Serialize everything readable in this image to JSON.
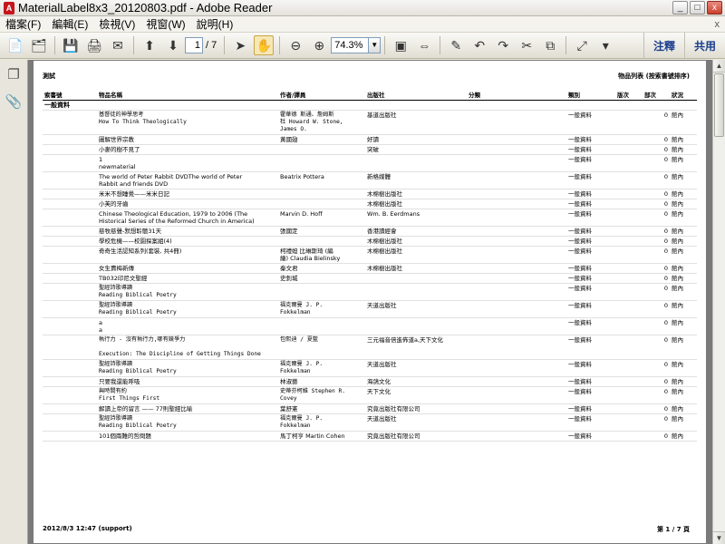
{
  "window": {
    "title": "MaterialLabel8x3_20120803.pdf - Adobe Reader",
    "buttons": [
      "_",
      "□",
      "x"
    ]
  },
  "menu": [
    "檔案(F)",
    "編輯(E)",
    "檢視(V)",
    "視窗(W)",
    "說明(H)"
  ],
  "menu_close": "x",
  "toolbar": {
    "page_current": "1",
    "page_total": "/ 7",
    "zoom": "74.3%",
    "comment_label": "注釋",
    "share_label": "共用"
  },
  "page": {
    "header_left": "測試",
    "header_right": "物品列表 (按索書號排序)",
    "columns": [
      "索書號",
      "物品名稱",
      "作者/譯員",
      "出版社",
      "分類",
      "類別",
      "版次",
      "部次",
      "狀況"
    ],
    "section": "一般資料",
    "rows": [
      {
        "title": "基督徒的神學思考\nHow To Think Theologically",
        "author": "霍華德 斯通、詹姆斯\n杜 Howard W. Stone,\nJames O.",
        "publisher": "基道出版社",
        "category": "一般資料",
        "copies": "0",
        "status": "館內",
        "mono": true
      },
      {
        "title": "圖解世界宗教",
        "author": "黃國翅",
        "publisher": "好讀",
        "category": "一般資料",
        "copies": "0",
        "status": "館內"
      },
      {
        "title": "小麥的樹不見了",
        "author": "",
        "publisher": "突破",
        "category": "一般資料",
        "copies": "0",
        "status": "館內"
      },
      {
        "title": "1\nnewmaterial",
        "author": "",
        "publisher": "",
        "category": "一般資料",
        "copies": "0",
        "status": "館內"
      },
      {
        "title": "The world of Peter Rabbit DVDThe world of Peter\nRabbit and friends DVD",
        "author": "Beatrix Pottera",
        "publisher": "新格媒體",
        "category": "一般資料",
        "copies": "0",
        "status": "館內"
      },
      {
        "title": "米米不想睡覺——米米日記",
        "author": "",
        "publisher": "木棉樹出版社",
        "category": "一般資料",
        "copies": "0",
        "status": "館內"
      },
      {
        "title": "小芙的牙齒",
        "author": "",
        "publisher": "木棉樹出版社",
        "category": "一般資料",
        "copies": "0",
        "status": "館內"
      },
      {
        "title": "Chinese Theological Education, 1979 to 2006 (The\nHistorical Series of the Reformed Church in America)",
        "author": "Marvin D. Hoff",
        "publisher": "Wm. B. Eerdmans",
        "category": "一般資料",
        "copies": "0",
        "status": "館內"
      },
      {
        "title": "慈牧慈聲-默想聆聽31天",
        "author": "張國定",
        "publisher": "香港讀經會",
        "category": "一般資料",
        "copies": "0",
        "status": "館內"
      },
      {
        "title": "學校危機——校園探案組(4)",
        "author": "",
        "publisher": "木棉樹出版社",
        "category": "一般資料",
        "copies": "0",
        "status": "館內"
      },
      {
        "title": "奇奇生活認知系列(套裝, 共4冊)",
        "author": "柯禮妲 比琳斯琦 (編\n繪) Claudia Bielinsky",
        "publisher": "木棉樹出版社",
        "category": "一般資料",
        "copies": "0",
        "status": "館內"
      },
      {
        "title": "女生賣梅新傳",
        "author": "秦文君",
        "publisher": "木棉樹出版社",
        "category": "一般資料",
        "copies": "0",
        "status": "館內"
      },
      {
        "title": "TB032印尼文聖經",
        "author": "史釗城",
        "publisher": "",
        "category": "一般資料",
        "copies": "0",
        "status": "館內"
      },
      {
        "title": "聖經詩歌導讀\nReading Biblical Poetry",
        "author": "",
        "publisher": "",
        "category": "一般資料",
        "copies": "0",
        "status": "館內",
        "mono": true
      },
      {
        "title": "聖經詩歌導讀\nReading Biblical Poetry",
        "author": "福克爾曼 J. P.\nFokkelman",
        "publisher": "天道出版社",
        "category": "一般資料",
        "copies": "0",
        "status": "館內",
        "mono": true
      },
      {
        "title": "a\na",
        "author": "",
        "publisher": "",
        "category": "一般資料",
        "copies": "0",
        "status": "館內"
      },
      {
        "title": "執行力 - 沒有執行力,哪有競爭力\n\nExecution: The Discipline of Getting Things Done",
        "author": "包熙迪 / 夏藍",
        "publisher": "三元福音倍進佈道a,天下文化",
        "category": "一般資料",
        "copies": "0",
        "status": "館內",
        "mono": true
      },
      {
        "title": "聖經詩歌導讀\nReading Biblical Poetry",
        "author": "福克爾曼 J. P.\nFokkelman",
        "publisher": "天道出版社",
        "category": "一般資料",
        "copies": "0",
        "status": "館內",
        "mono": true
      },
      {
        "title": "只要我還能呼吸",
        "author": "林淑藝",
        "publisher": "海鴿文化",
        "category": "一般資料",
        "copies": "0",
        "status": "館內"
      },
      {
        "title": "與時間有約\nFirst Things First",
        "author": "史蒂芬柯維 Stephen R.\nCovey",
        "publisher": "天下文化",
        "category": "一般資料",
        "copies": "0",
        "status": "館內",
        "mono": true
      },
      {
        "title": "解讀上帝的留言 —— 77則聖經比喻",
        "author": "葉舒憲",
        "publisher": "究竟出版社有限公司",
        "category": "一般資料",
        "copies": "0",
        "status": "館內"
      },
      {
        "title": "聖經詩歌導讀\nReading Biblical Poetry",
        "author": "福克爾曼 J. P.\nFokkelman",
        "publisher": "天道出版社",
        "category": "一般資料",
        "copies": "0",
        "status": "館內",
        "mono": true
      },
      {
        "title": "101個兩難的哲問題",
        "author": "馬丁柯亨 Martin Cohen",
        "publisher": "究竟出版社有限公司",
        "category": "一般資料",
        "copies": "0",
        "status": "館內"
      }
    ],
    "footer_left": "2012/8/3 12:47 (support)",
    "footer_right": "第 1 / 7 頁"
  }
}
